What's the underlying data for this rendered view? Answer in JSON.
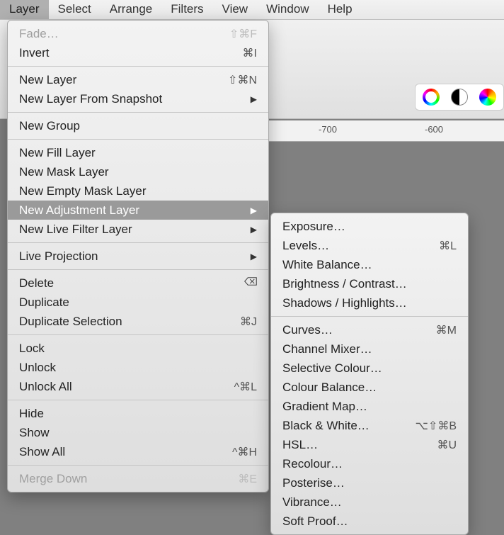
{
  "menubar": [
    "Layer",
    "Select",
    "Arrange",
    "Filters",
    "View",
    "Window",
    "Help"
  ],
  "menubarActive": 0,
  "ruler": {
    "t0": "-700",
    "t1": "-600"
  },
  "menu": [
    {
      "label": "Fade…",
      "shortcut": "⇧⌘F",
      "disabled": true
    },
    {
      "label": "Invert",
      "shortcut": "⌘I"
    },
    {
      "sep": true
    },
    {
      "label": "New Layer",
      "shortcut": "⇧⌘N"
    },
    {
      "label": "New Layer From Snapshot",
      "submenu": true
    },
    {
      "sep": true
    },
    {
      "label": "New Group"
    },
    {
      "sep": true
    },
    {
      "label": "New Fill Layer"
    },
    {
      "label": "New Mask Layer"
    },
    {
      "label": "New Empty Mask Layer"
    },
    {
      "label": "New Adjustment Layer",
      "submenu": true,
      "hl": true
    },
    {
      "label": "New Live Filter Layer",
      "submenu": true
    },
    {
      "sep": true
    },
    {
      "label": "Live Projection",
      "submenu": true
    },
    {
      "sep": true
    },
    {
      "label": "Delete",
      "delicon": true
    },
    {
      "label": "Duplicate"
    },
    {
      "label": "Duplicate Selection",
      "shortcut": "⌘J"
    },
    {
      "sep": true
    },
    {
      "label": "Lock"
    },
    {
      "label": "Unlock"
    },
    {
      "label": "Unlock All",
      "shortcut": "^⌘L"
    },
    {
      "sep": true
    },
    {
      "label": "Hide"
    },
    {
      "label": "Show"
    },
    {
      "label": "Show All",
      "shortcut": "^⌘H"
    },
    {
      "sep": true
    },
    {
      "label": "Merge Down",
      "shortcut": "⌘E",
      "disabled": true
    }
  ],
  "submenu": [
    {
      "label": "Exposure…"
    },
    {
      "label": "Levels…",
      "shortcut": "⌘L"
    },
    {
      "label": "White Balance…"
    },
    {
      "label": "Brightness / Contrast…"
    },
    {
      "label": "Shadows / Highlights…"
    },
    {
      "sep": true
    },
    {
      "label": "Curves…",
      "shortcut": "⌘M"
    },
    {
      "label": "Channel Mixer…"
    },
    {
      "label": "Selective Colour…"
    },
    {
      "label": "Colour Balance…"
    },
    {
      "label": "Gradient Map…"
    },
    {
      "label": "Black & White…",
      "shortcut": "⌥⇧⌘B"
    },
    {
      "label": "HSL…",
      "shortcut": "⌘U"
    },
    {
      "label": "Recolour…"
    },
    {
      "label": "Posterise…"
    },
    {
      "label": "Vibrance…"
    },
    {
      "label": "Soft Proof…"
    }
  ]
}
